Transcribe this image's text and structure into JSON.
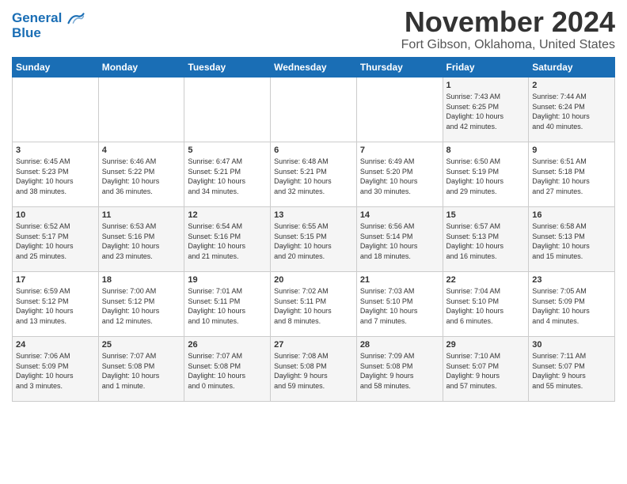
{
  "header": {
    "logo_line1": "General",
    "logo_line2": "Blue",
    "month": "November 2024",
    "location": "Fort Gibson, Oklahoma, United States"
  },
  "weekdays": [
    "Sunday",
    "Monday",
    "Tuesday",
    "Wednesday",
    "Thursday",
    "Friday",
    "Saturday"
  ],
  "weeks": [
    [
      {
        "day": "",
        "text": ""
      },
      {
        "day": "",
        "text": ""
      },
      {
        "day": "",
        "text": ""
      },
      {
        "day": "",
        "text": ""
      },
      {
        "day": "",
        "text": ""
      },
      {
        "day": "1",
        "text": "Sunrise: 7:43 AM\nSunset: 6:25 PM\nDaylight: 10 hours\nand 42 minutes."
      },
      {
        "day": "2",
        "text": "Sunrise: 7:44 AM\nSunset: 6:24 PM\nDaylight: 10 hours\nand 40 minutes."
      }
    ],
    [
      {
        "day": "3",
        "text": "Sunrise: 6:45 AM\nSunset: 5:23 PM\nDaylight: 10 hours\nand 38 minutes."
      },
      {
        "day": "4",
        "text": "Sunrise: 6:46 AM\nSunset: 5:22 PM\nDaylight: 10 hours\nand 36 minutes."
      },
      {
        "day": "5",
        "text": "Sunrise: 6:47 AM\nSunset: 5:21 PM\nDaylight: 10 hours\nand 34 minutes."
      },
      {
        "day": "6",
        "text": "Sunrise: 6:48 AM\nSunset: 5:21 PM\nDaylight: 10 hours\nand 32 minutes."
      },
      {
        "day": "7",
        "text": "Sunrise: 6:49 AM\nSunset: 5:20 PM\nDaylight: 10 hours\nand 30 minutes."
      },
      {
        "day": "8",
        "text": "Sunrise: 6:50 AM\nSunset: 5:19 PM\nDaylight: 10 hours\nand 29 minutes."
      },
      {
        "day": "9",
        "text": "Sunrise: 6:51 AM\nSunset: 5:18 PM\nDaylight: 10 hours\nand 27 minutes."
      }
    ],
    [
      {
        "day": "10",
        "text": "Sunrise: 6:52 AM\nSunset: 5:17 PM\nDaylight: 10 hours\nand 25 minutes."
      },
      {
        "day": "11",
        "text": "Sunrise: 6:53 AM\nSunset: 5:16 PM\nDaylight: 10 hours\nand 23 minutes."
      },
      {
        "day": "12",
        "text": "Sunrise: 6:54 AM\nSunset: 5:16 PM\nDaylight: 10 hours\nand 21 minutes."
      },
      {
        "day": "13",
        "text": "Sunrise: 6:55 AM\nSunset: 5:15 PM\nDaylight: 10 hours\nand 20 minutes."
      },
      {
        "day": "14",
        "text": "Sunrise: 6:56 AM\nSunset: 5:14 PM\nDaylight: 10 hours\nand 18 minutes."
      },
      {
        "day": "15",
        "text": "Sunrise: 6:57 AM\nSunset: 5:13 PM\nDaylight: 10 hours\nand 16 minutes."
      },
      {
        "day": "16",
        "text": "Sunrise: 6:58 AM\nSunset: 5:13 PM\nDaylight: 10 hours\nand 15 minutes."
      }
    ],
    [
      {
        "day": "17",
        "text": "Sunrise: 6:59 AM\nSunset: 5:12 PM\nDaylight: 10 hours\nand 13 minutes."
      },
      {
        "day": "18",
        "text": "Sunrise: 7:00 AM\nSunset: 5:12 PM\nDaylight: 10 hours\nand 12 minutes."
      },
      {
        "day": "19",
        "text": "Sunrise: 7:01 AM\nSunset: 5:11 PM\nDaylight: 10 hours\nand 10 minutes."
      },
      {
        "day": "20",
        "text": "Sunrise: 7:02 AM\nSunset: 5:11 PM\nDaylight: 10 hours\nand 8 minutes."
      },
      {
        "day": "21",
        "text": "Sunrise: 7:03 AM\nSunset: 5:10 PM\nDaylight: 10 hours\nand 7 minutes."
      },
      {
        "day": "22",
        "text": "Sunrise: 7:04 AM\nSunset: 5:10 PM\nDaylight: 10 hours\nand 6 minutes."
      },
      {
        "day": "23",
        "text": "Sunrise: 7:05 AM\nSunset: 5:09 PM\nDaylight: 10 hours\nand 4 minutes."
      }
    ],
    [
      {
        "day": "24",
        "text": "Sunrise: 7:06 AM\nSunset: 5:09 PM\nDaylight: 10 hours\nand 3 minutes."
      },
      {
        "day": "25",
        "text": "Sunrise: 7:07 AM\nSunset: 5:08 PM\nDaylight: 10 hours\nand 1 minute."
      },
      {
        "day": "26",
        "text": "Sunrise: 7:07 AM\nSunset: 5:08 PM\nDaylight: 10 hours\nand 0 minutes."
      },
      {
        "day": "27",
        "text": "Sunrise: 7:08 AM\nSunset: 5:08 PM\nDaylight: 9 hours\nand 59 minutes."
      },
      {
        "day": "28",
        "text": "Sunrise: 7:09 AM\nSunset: 5:08 PM\nDaylight: 9 hours\nand 58 minutes."
      },
      {
        "day": "29",
        "text": "Sunrise: 7:10 AM\nSunset: 5:07 PM\nDaylight: 9 hours\nand 57 minutes."
      },
      {
        "day": "30",
        "text": "Sunrise: 7:11 AM\nSunset: 5:07 PM\nDaylight: 9 hours\nand 55 minutes."
      }
    ]
  ]
}
